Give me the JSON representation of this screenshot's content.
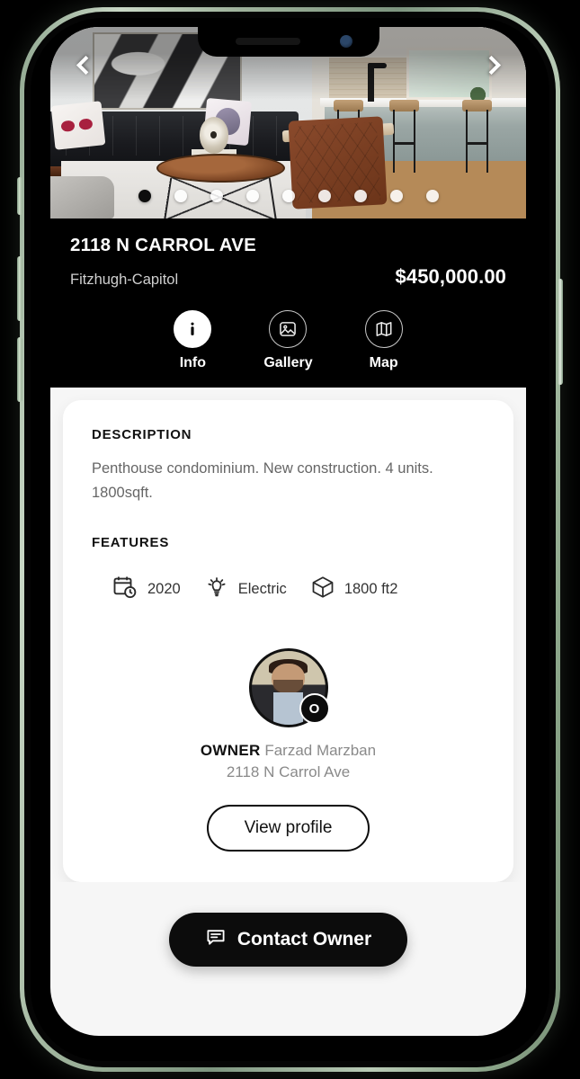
{
  "gallery": {
    "prev_label": "Previous image",
    "next_label": "Next image",
    "dot_count": 9,
    "active_index": 0,
    "scene_left": "living room with dark velvet sofa, wood coffee table, skull pillows and abstract art",
    "scene_right": "kitchen island with three bar stools, brown leather chair and wood floors"
  },
  "property": {
    "address": "2118 N CARROL AVE",
    "neighborhood": "Fitzhugh-Capitol",
    "price": "$450,000.00"
  },
  "tabs": [
    {
      "label": "Info",
      "icon": "info-icon",
      "active": true
    },
    {
      "label": "Gallery",
      "icon": "image-icon",
      "active": false
    },
    {
      "label": "Map",
      "icon": "map-icon",
      "active": false
    }
  ],
  "description": {
    "heading": "DESCRIPTION",
    "body": "Penthouse condominium. New construction. 4 units. 1800sqft."
  },
  "features": {
    "heading": "FEATURES",
    "items": [
      {
        "icon": "calendar-clock-icon",
        "label": "2020"
      },
      {
        "icon": "lightbulb-icon",
        "label": "Electric"
      },
      {
        "icon": "cube-icon",
        "label": "1800 ft2"
      }
    ]
  },
  "owner": {
    "role_label": "OWNER",
    "name": "Farzad Marzban",
    "address": "2118 N Carrol Ave",
    "badge": "O",
    "view_profile_label": "View profile"
  },
  "cta": {
    "label": "Contact Owner",
    "icon": "chat-bubble-icon"
  },
  "colors": {
    "header_bg": "#000000",
    "page_bg": "#f6f6f6",
    "card_bg": "#ffffff",
    "accent": "#0c0c0c",
    "muted_text": "#8a8a8a",
    "frame": "#93a893"
  }
}
